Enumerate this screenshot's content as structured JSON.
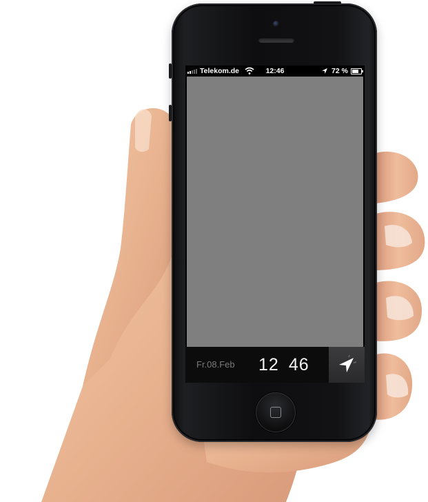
{
  "status_bar": {
    "carrier": "Telekom.de",
    "time": "12:46",
    "battery_percent": "72 %",
    "battery_level": 0.72,
    "signal_bars": 2
  },
  "bottom_bar": {
    "date": "Fr.08.Feb",
    "clock_hours": "12",
    "clock_minutes": "46",
    "nav_icon": "navigation-arrow-icon"
  },
  "colors": {
    "content_background": "#7f7f7f",
    "phone_body": "#111214",
    "bottom_bar": "#0c0c0d"
  }
}
